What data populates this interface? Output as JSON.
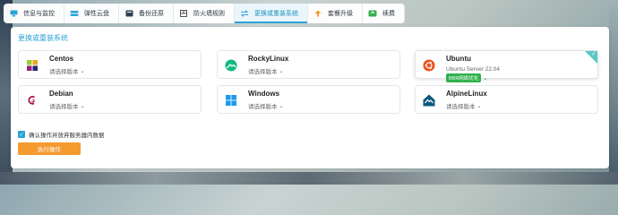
{
  "tabs": [
    {
      "label": "信息与监控",
      "icon": "monitor-icon"
    },
    {
      "label": "弹性云盘",
      "icon": "cloud-disk-icon"
    },
    {
      "label": "备份还原",
      "icon": "backup-icon"
    },
    {
      "label": "防火墙规则",
      "icon": "firewall-icon"
    },
    {
      "label": "更换或重装系统",
      "icon": "swap-icon",
      "active": true
    },
    {
      "label": "套餐升级",
      "icon": "upgrade-icon"
    },
    {
      "label": "续费",
      "icon": "renew-icon"
    }
  ],
  "panel": {
    "title": "更换或重装系统"
  },
  "os_options": [
    {
      "name": "Centos",
      "sub": "请选择版本"
    },
    {
      "name": "RockyLinux",
      "sub": "请选择版本"
    },
    {
      "name": "Ubuntu",
      "sub": "Ubuntu Server 22.04",
      "badge": "BBR网络优化",
      "selected": true
    },
    {
      "name": "Debian",
      "sub": "请选择版本"
    },
    {
      "name": "Windows",
      "sub": "请选择版本"
    },
    {
      "name": "AlpineLinux",
      "sub": "请选择版本"
    }
  ],
  "confirm_label": "确认操作并放弃服务器内数据",
  "execute_label": "执行操作",
  "colors": {
    "accent": "#2aa3d6",
    "execute": "#f49a2f",
    "badge": "#2fb04c"
  }
}
